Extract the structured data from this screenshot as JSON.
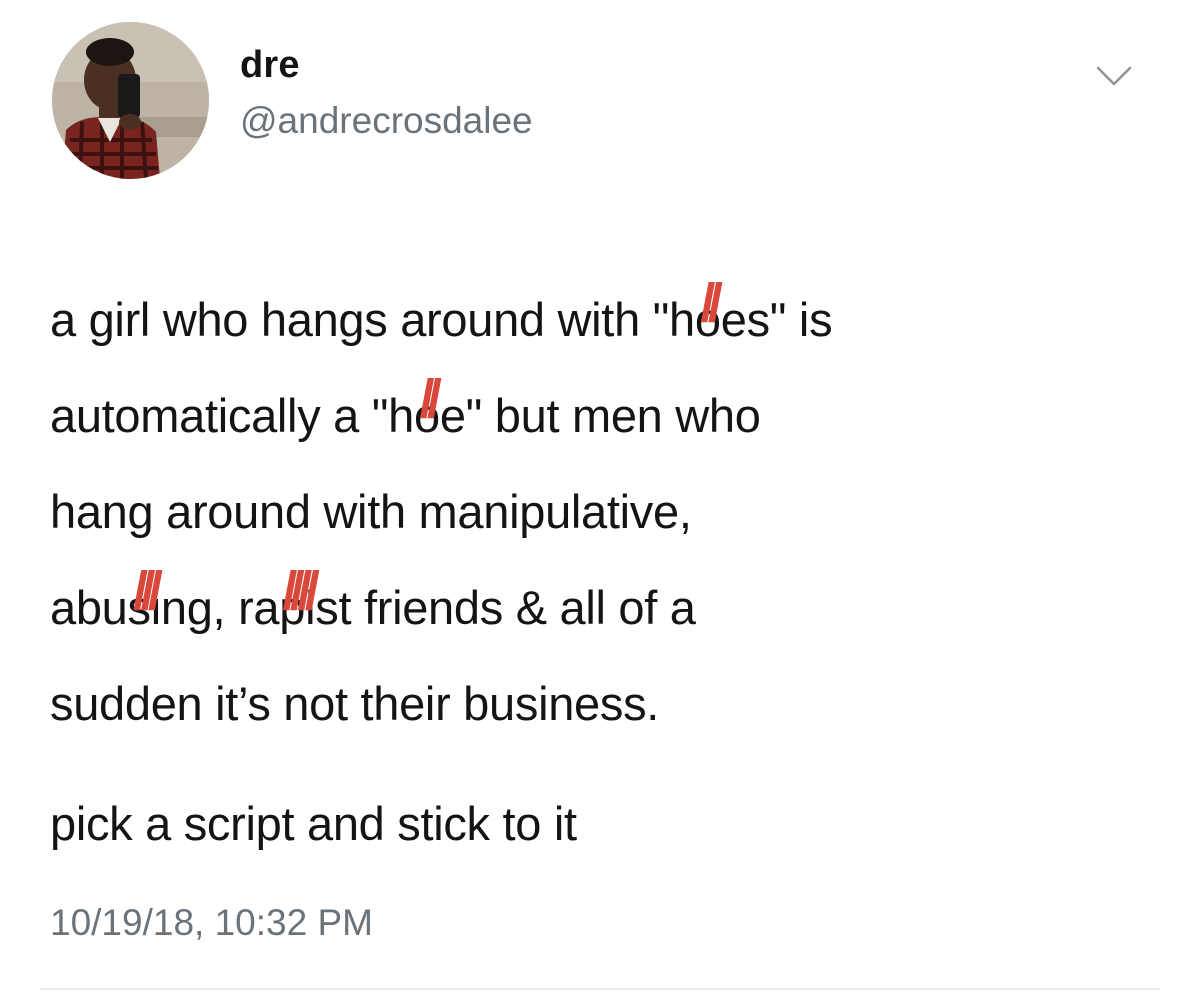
{
  "tweet": {
    "author": {
      "display_name": "dre",
      "handle": "@andrecrosdalee",
      "avatar_icon": "profile-photo-avatar"
    },
    "menu_icon": "chevron-down-icon",
    "body": {
      "line1": {
        "pre": "a girl who hangs around with \"h",
        "struck": "o",
        "post": "es\" is"
      },
      "line2": {
        "pre": "automatically a \"h",
        "struck": "o",
        "post": "e\" but men who"
      },
      "line3": {
        "text": "hang around with manipulative,"
      },
      "line4": {
        "pre1": "abu",
        "struck1": "si",
        "mid": "ng, ra",
        "struck2": "pi",
        "post": "st friends & all of a"
      },
      "line5": {
        "text": "sudden it’s not their business."
      }
    },
    "closing": "pick a script and stick to it",
    "timestamp": "10/19/18, 10:32 PM",
    "colors": {
      "text": "#141414",
      "secondary": "#6b737a",
      "strike": "#d9483b",
      "background": "#ffffff"
    }
  }
}
